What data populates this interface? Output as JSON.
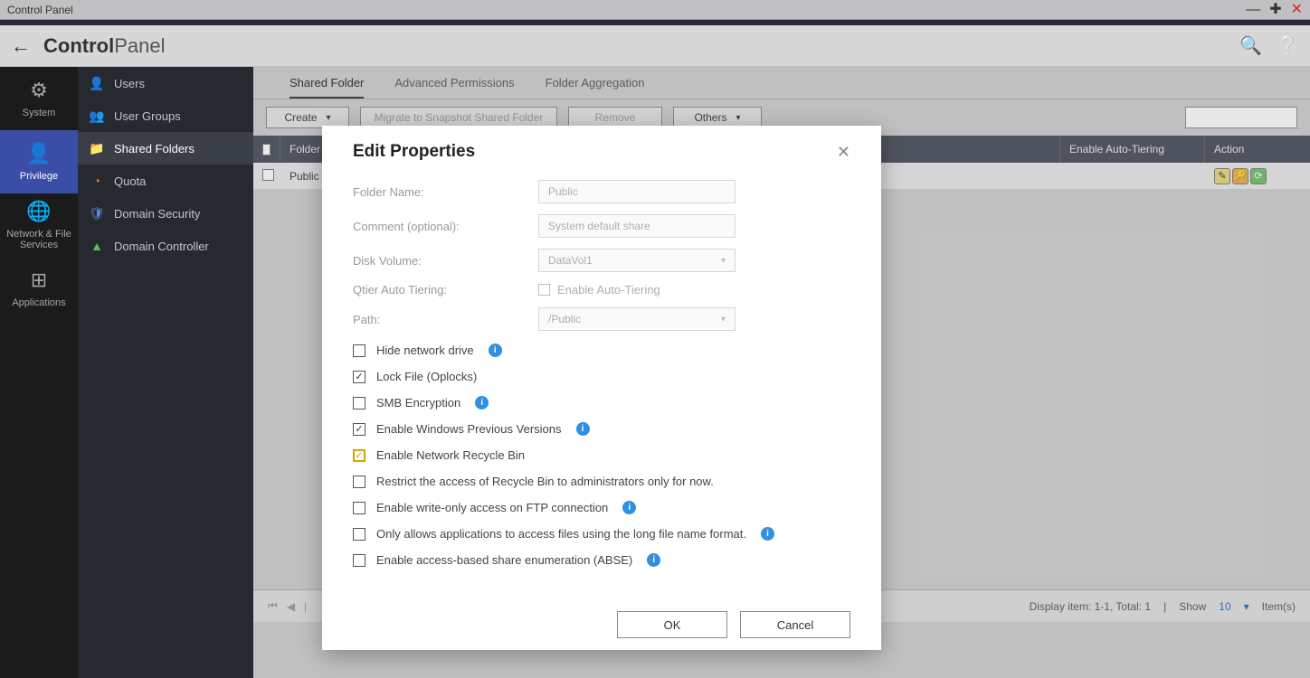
{
  "window": {
    "title": "Control Panel"
  },
  "header": {
    "title_bold": "Control",
    "title_light": "Panel"
  },
  "rail": {
    "items": [
      {
        "label": "System"
      },
      {
        "label": "Privilege"
      },
      {
        "label": "Network & File Services"
      },
      {
        "label": "Applications"
      }
    ]
  },
  "sidebar": {
    "items": [
      {
        "label": "Users"
      },
      {
        "label": "User Groups"
      },
      {
        "label": "Shared Folders"
      },
      {
        "label": "Quota"
      },
      {
        "label": "Domain Security"
      },
      {
        "label": "Domain Controller"
      }
    ]
  },
  "tabs": {
    "items": [
      {
        "label": "Shared Folder"
      },
      {
        "label": "Advanced Permissions"
      },
      {
        "label": "Folder Aggregation"
      }
    ]
  },
  "toolbar": {
    "create": "Create",
    "migrate": "Migrate to Snapshot Shared Folder",
    "remove": "Remove",
    "others": "Others"
  },
  "table": {
    "headers": {
      "folder": "Folder",
      "auto": "Enable Auto-Tiering",
      "action": "Action"
    },
    "rows": [
      {
        "folder": "Public"
      }
    ]
  },
  "footer": {
    "display": "Display item: 1-1, Total: 1",
    "show_label": "Show",
    "show_value": "10",
    "items_label": "Item(s)"
  },
  "modal": {
    "title": "Edit Properties",
    "fields": {
      "folder_name_label": "Folder Name:",
      "folder_name_value": "Public",
      "comment_label": "Comment (optional):",
      "comment_value": "System default share",
      "disk_volume_label": "Disk Volume:",
      "disk_volume_value": "DataVol1",
      "qtier_label": "Qtier Auto Tiering:",
      "qtier_chk_label": "Enable Auto-Tiering",
      "path_label": "Path:",
      "path_value": "/Public"
    },
    "options": [
      {
        "label": "Hide network drive",
        "checked": false,
        "info": true
      },
      {
        "label": "Lock File (Oplocks)",
        "checked": true,
        "info": false
      },
      {
        "label": "SMB Encryption",
        "checked": false,
        "info": true
      },
      {
        "label": "Enable Windows Previous Versions",
        "checked": true,
        "info": true
      },
      {
        "label": "Enable Network Recycle Bin",
        "checked": true,
        "info": false,
        "highlight": true
      },
      {
        "label": "Restrict the access of Recycle Bin to administrators only for now.",
        "checked": false,
        "info": false
      },
      {
        "label": "Enable write-only access on FTP connection",
        "checked": false,
        "info": true
      },
      {
        "label": "Only allows applications to access files using the long file name format.",
        "checked": false,
        "info": true
      },
      {
        "label": "Enable access-based share enumeration (ABSE)",
        "checked": false,
        "info": true
      }
    ],
    "ok": "OK",
    "cancel": "Cancel"
  }
}
